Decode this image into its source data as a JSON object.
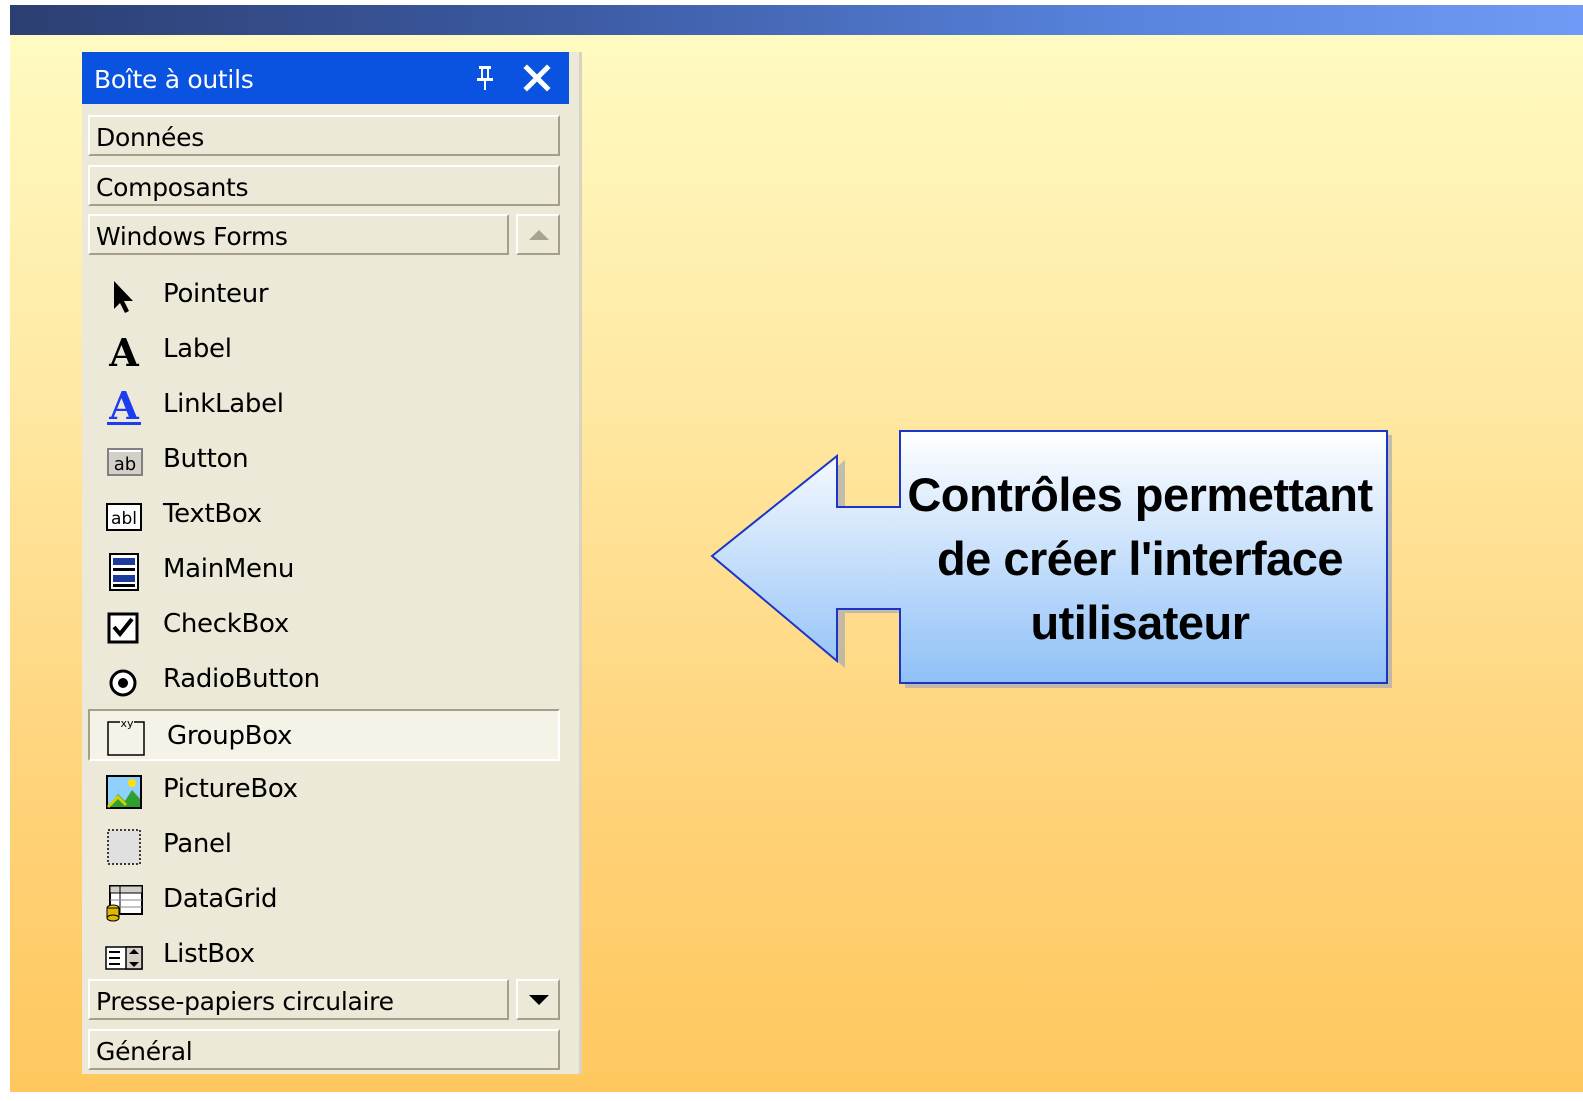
{
  "toolbox": {
    "title": "Boîte à outils",
    "pin_icon": "pin-icon",
    "close_icon": "close-icon",
    "sections_top": [
      {
        "label": "Données"
      },
      {
        "label": "Composants"
      },
      {
        "label": "Windows Forms",
        "expanded": true
      }
    ],
    "items": [
      {
        "label": "Pointeur",
        "icon": "pointer-icon"
      },
      {
        "label": "Label",
        "icon": "label-icon"
      },
      {
        "label": "LinkLabel",
        "icon": "linklabel-icon"
      },
      {
        "label": "Button",
        "icon": "button-icon"
      },
      {
        "label": "TextBox",
        "icon": "textbox-icon"
      },
      {
        "label": "MainMenu",
        "icon": "mainmenu-icon"
      },
      {
        "label": "CheckBox",
        "icon": "checkbox-icon"
      },
      {
        "label": "RadioButton",
        "icon": "radiobutton-icon"
      },
      {
        "label": "GroupBox",
        "icon": "groupbox-icon",
        "selected": true
      },
      {
        "label": "PictureBox",
        "icon": "picturebox-icon"
      },
      {
        "label": "Panel",
        "icon": "panel-icon"
      },
      {
        "label": "DataGrid",
        "icon": "datagrid-icon"
      },
      {
        "label": "ListBox",
        "icon": "listbox-icon"
      }
    ],
    "sections_bottom": [
      {
        "label": "Presse-papiers circulaire"
      },
      {
        "label": "Général"
      }
    ]
  },
  "callout": {
    "lines": [
      "Contrôles permettant",
      "de créer l'interface",
      "utilisateur"
    ]
  },
  "colors": {
    "title_bar": "#0a52e0",
    "panel_bg": "#ece9d8",
    "callout_fill_top": "#ffffff",
    "callout_fill_bottom": "#8fc0f7",
    "callout_border": "#1a35c8"
  }
}
